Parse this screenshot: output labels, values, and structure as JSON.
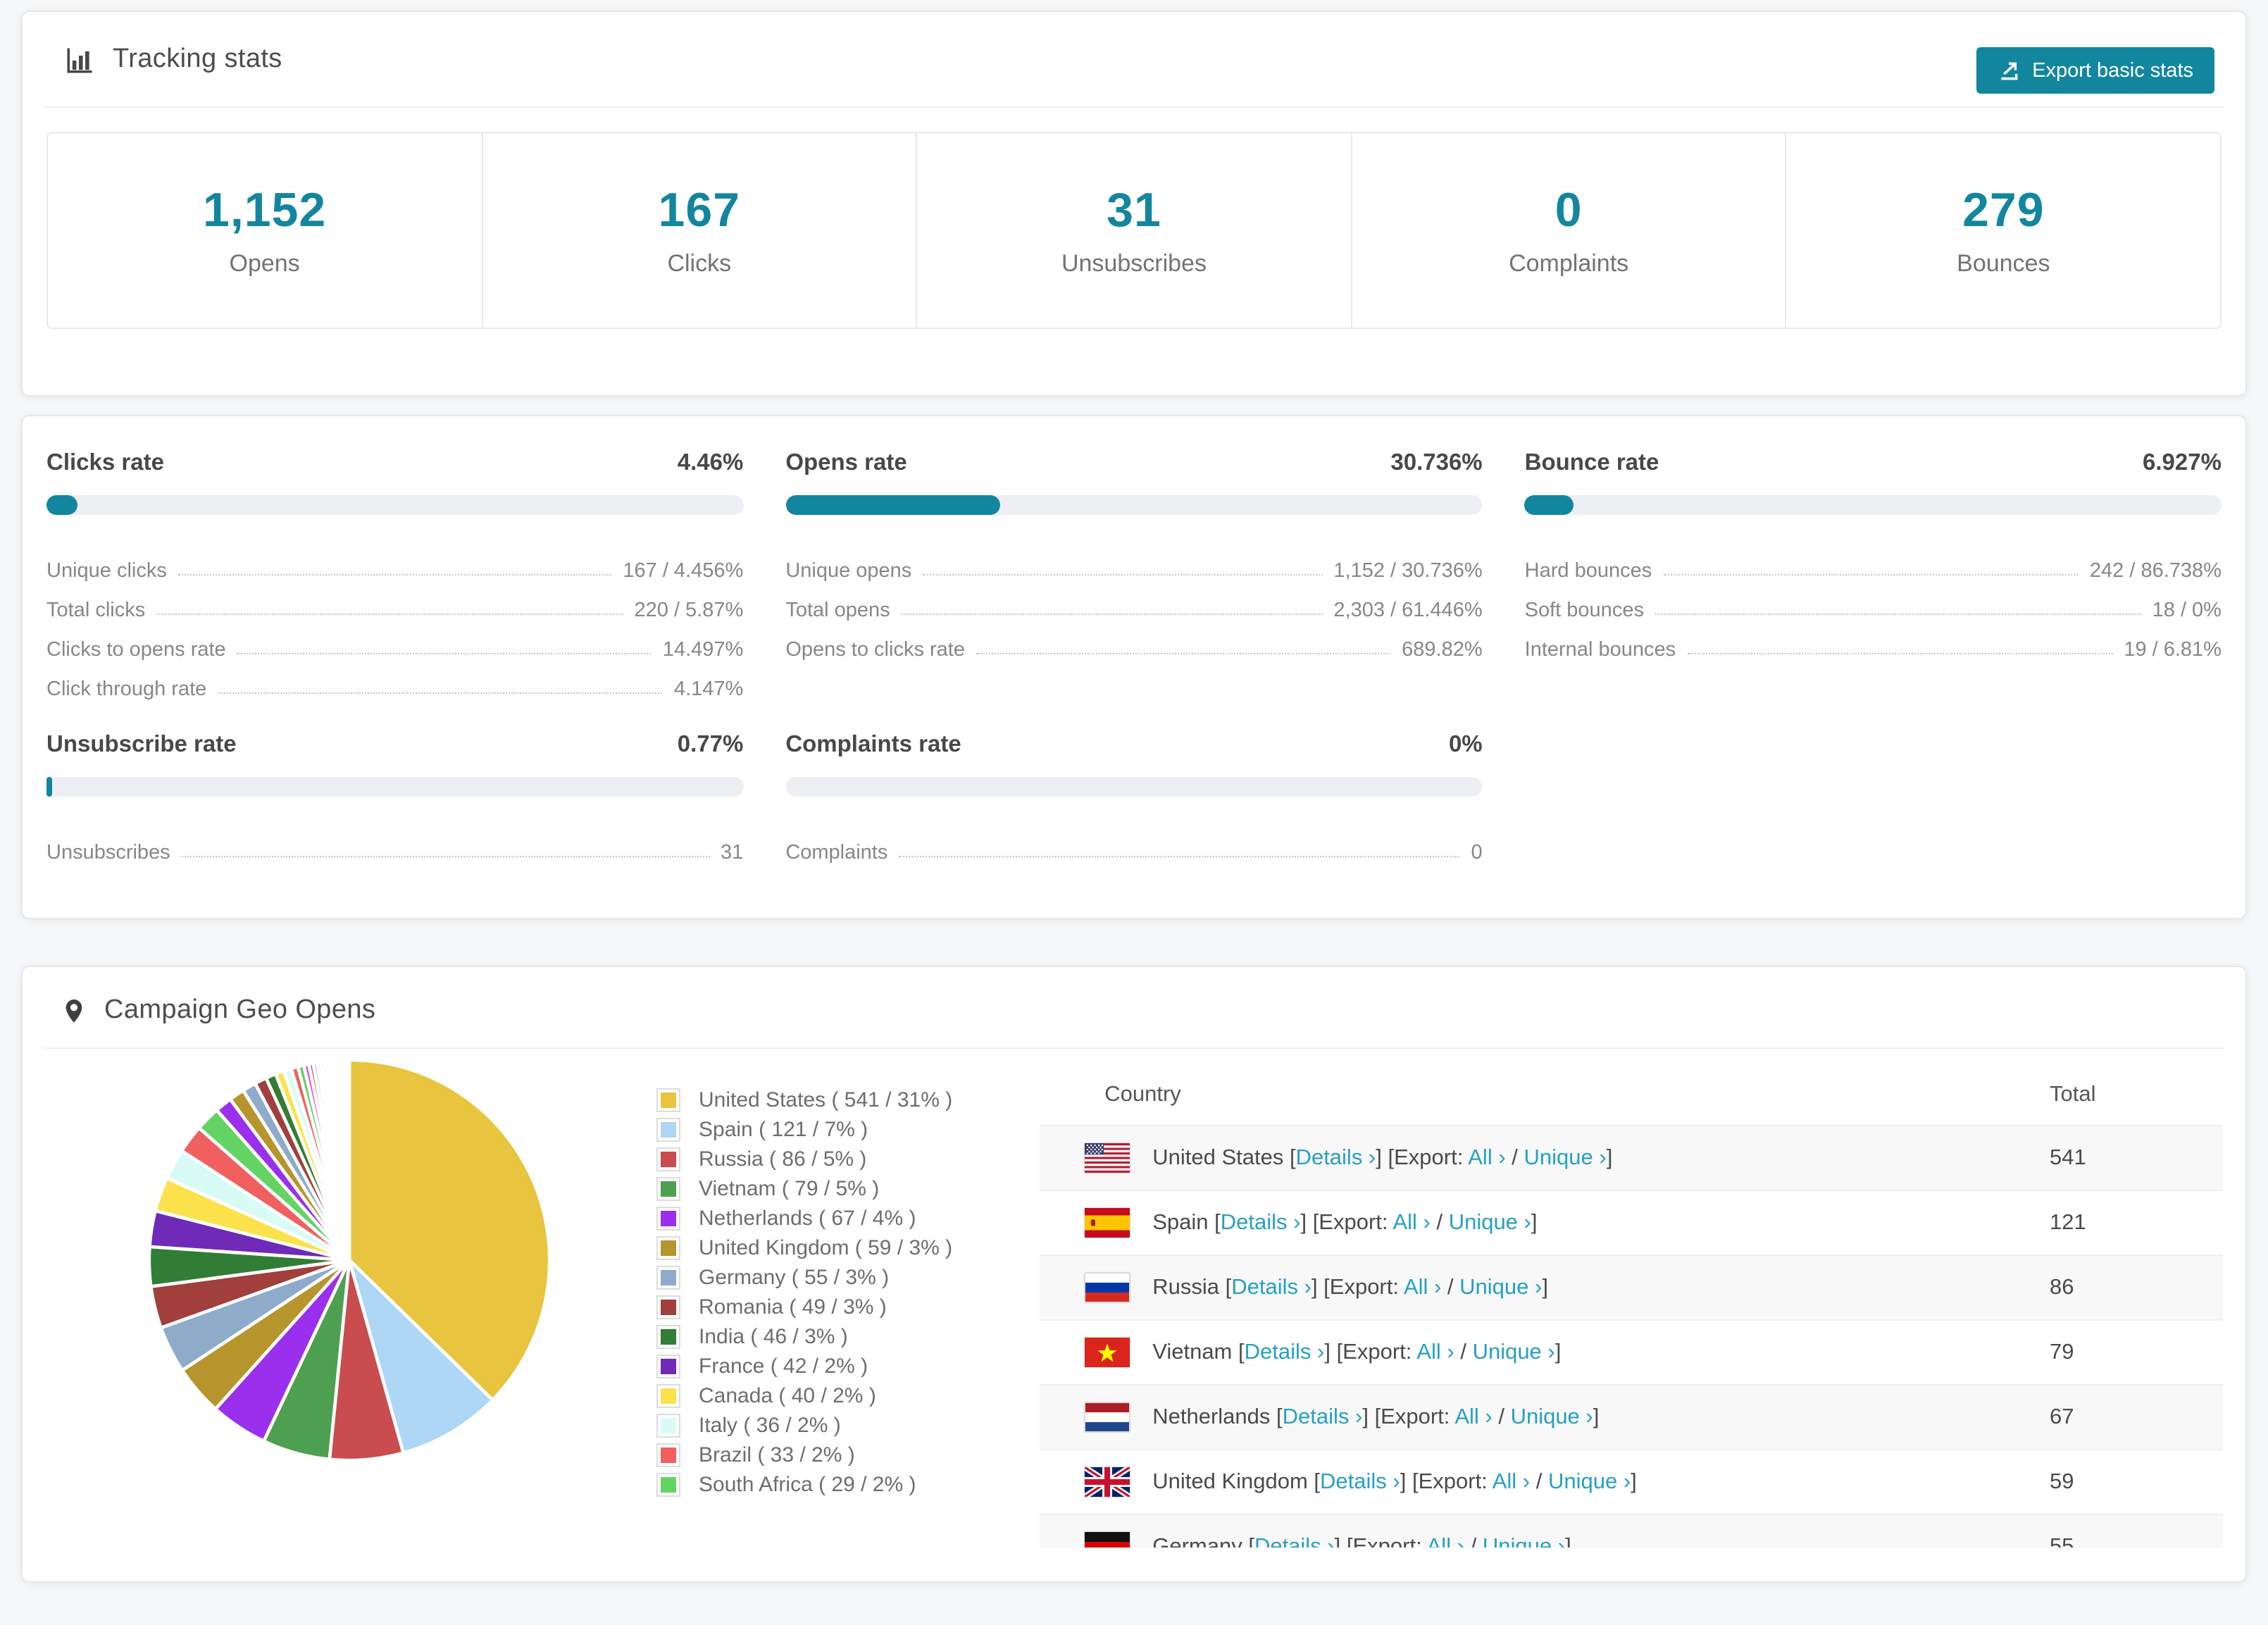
{
  "accent": {
    "teal": "#13869f",
    "link": "#26a0c2"
  },
  "tracking": {
    "title": "Tracking stats",
    "export_button": "Export basic stats",
    "stats": [
      {
        "value": "1,152",
        "label": "Opens"
      },
      {
        "value": "167",
        "label": "Clicks"
      },
      {
        "value": "31",
        "label": "Unsubscribes"
      },
      {
        "value": "0",
        "label": "Complaints"
      },
      {
        "value": "279",
        "label": "Bounces"
      }
    ]
  },
  "rates": [
    {
      "title": "Clicks rate",
      "value": "4.46%",
      "percent": 4.46,
      "rows": [
        {
          "label": "Unique clicks",
          "value": "167 / 4.456%"
        },
        {
          "label": "Total clicks",
          "value": "220 / 5.87%"
        },
        {
          "label": "Clicks to opens rate",
          "value": "14.497%"
        },
        {
          "label": "Click through rate",
          "value": "4.147%"
        }
      ]
    },
    {
      "title": "Opens rate",
      "value": "30.736%",
      "percent": 30.736,
      "rows": [
        {
          "label": "Unique opens",
          "value": "1,152 / 30.736%"
        },
        {
          "label": "Total opens",
          "value": "2,303 / 61.446%"
        },
        {
          "label": "Opens to clicks rate",
          "value": "689.82%"
        }
      ]
    },
    {
      "title": "Bounce rate",
      "value": "6.927%",
      "percent": 6.927,
      "rows": [
        {
          "label": "Hard bounces",
          "value": "242 / 86.738%"
        },
        {
          "label": "Soft bounces",
          "value": "18 / 0%"
        },
        {
          "label": "Internal bounces",
          "value": "19 / 6.81%"
        }
      ]
    },
    {
      "title": "Unsubscribe rate",
      "value": "0.77%",
      "percent": 0.77,
      "rows": [
        {
          "label": "Unsubscribes",
          "value": "31"
        }
      ]
    },
    {
      "title": "Complaints rate",
      "value": "0%",
      "percent": 0,
      "rows": [
        {
          "label": "Complaints",
          "value": "0"
        }
      ]
    }
  ],
  "geo": {
    "title": "Campaign Geo Opens",
    "table": {
      "headers": [
        "Country",
        "Total"
      ],
      "links": {
        "details": "Details ›",
        "all": "All ›",
        "unique": "Unique ›",
        "bracket_open": "[",
        "after_details": "] [Export: ",
        "slash": " / ",
        "bracket_close": "]"
      }
    },
    "legend_format": {
      "open": " ( ",
      "mid": " / ",
      "close": "% )"
    },
    "chart_data": {
      "type": "pie",
      "legend_position": "right",
      "series": [
        {
          "label": "United States",
          "value": 541,
          "pct": 31,
          "color": "#e8c43f",
          "flag": "us"
        },
        {
          "label": "Spain",
          "value": 121,
          "pct": 7,
          "color": "#aed6f5",
          "flag": "es"
        },
        {
          "label": "Russia",
          "value": 86,
          "pct": 5,
          "color": "#c94c4e",
          "flag": "ru"
        },
        {
          "label": "Vietnam",
          "value": 79,
          "pct": 5,
          "color": "#4da04f",
          "flag": "vn"
        },
        {
          "label": "Netherlands",
          "value": 67,
          "pct": 4,
          "color": "#9a30ee",
          "flag": "nl"
        },
        {
          "label": "United Kingdom",
          "value": 59,
          "pct": 3,
          "color": "#b6952c",
          "flag": "gb"
        },
        {
          "label": "Germany",
          "value": 55,
          "pct": 3,
          "color": "#8fabca",
          "flag": "de"
        },
        {
          "label": "Romania",
          "value": 49,
          "pct": 3,
          "color": "#a03f3c"
        },
        {
          "label": "India",
          "value": 46,
          "pct": 3,
          "color": "#317d35"
        },
        {
          "label": "France",
          "value": 42,
          "pct": 2,
          "color": "#6f2ab8"
        },
        {
          "label": "Canada",
          "value": 40,
          "pct": 2,
          "color": "#fbe24b"
        },
        {
          "label": "Italy",
          "value": 36,
          "pct": 2,
          "color": "#d9fbf6"
        },
        {
          "label": "Brazil",
          "value": 33,
          "pct": 2,
          "color": "#f25f5f"
        },
        {
          "label": "South Africa",
          "value": 29,
          "pct": 2,
          "color": "#63d463"
        }
      ],
      "others_values": [
        20,
        18,
        16,
        14,
        12,
        10,
        9,
        8,
        7,
        6,
        5,
        5,
        4,
        4,
        3,
        3,
        2.5,
        2.5,
        2,
        2,
        1.8,
        1.6,
        1.4,
        1.2,
        1,
        1,
        0.9,
        0.8,
        0.7,
        0.6,
        0.5,
        0.5,
        0.4,
        0.4,
        0.3,
        0.3,
        0.2,
        0.2,
        0.15,
        0.1
      ],
      "others_palette": [
        "#9a30ee",
        "#b6952c",
        "#8fabca",
        "#a03f3c",
        "#317d35",
        "#fbe24b",
        "#d9fbf6",
        "#f25f5f",
        "#63d463",
        "#e24ce2",
        "#c94c4e",
        "#aed6f5",
        "#6f2ab8",
        "#4da04f",
        "#e8c43f",
        "#7a6000",
        "#33657f",
        "#5c1a1a",
        "#123c12",
        "#26185c",
        "#0f4d4d",
        "#ff5c8a"
      ]
    }
  }
}
